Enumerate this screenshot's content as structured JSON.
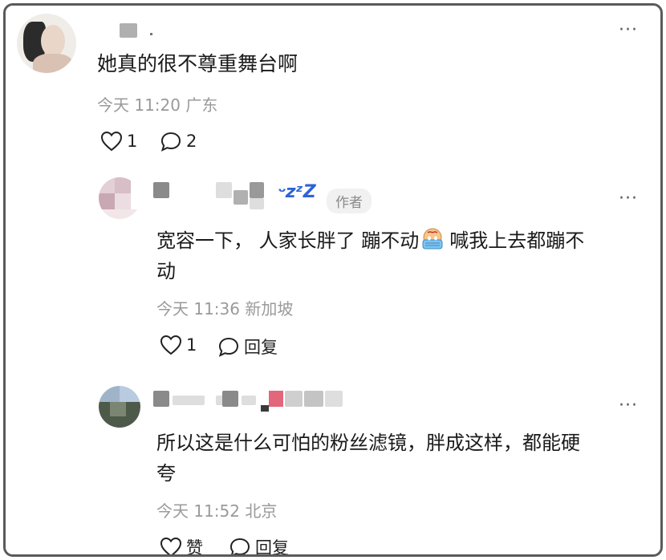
{
  "comments": [
    {
      "text": "她真的很不尊重舞台啊",
      "time": "今天 11:20",
      "location": "广东",
      "likes": "1",
      "replies": "2"
    },
    {
      "text_line1": "宽容一下， 人家长胖了 蹦不动",
      "text_line1b": "喊我上去都蹦不",
      "text_line2": "动",
      "name_emoji": "ᵕzᶻZ",
      "badge": "作者",
      "time": "今天 11:36",
      "location": "新加坡",
      "likes": "1",
      "reply_label": "回复"
    },
    {
      "text_line1": "所以这是什么可怕的粉丝滤镜，胖成这样，都能硬",
      "text_line2": "夸",
      "time": "今天 11:52",
      "location": "北京",
      "like_label": "赞",
      "reply_label": "回复"
    }
  ],
  "more_label": "···",
  "icons": {
    "like": "heart-outline-icon",
    "comment": "speech-bubble-icon",
    "emoji": "crying-face-emoji-icon"
  },
  "colors": {
    "text": "#1a1a1a",
    "meta": "#9a9a9a",
    "badge_bg": "#f1f1f1"
  }
}
